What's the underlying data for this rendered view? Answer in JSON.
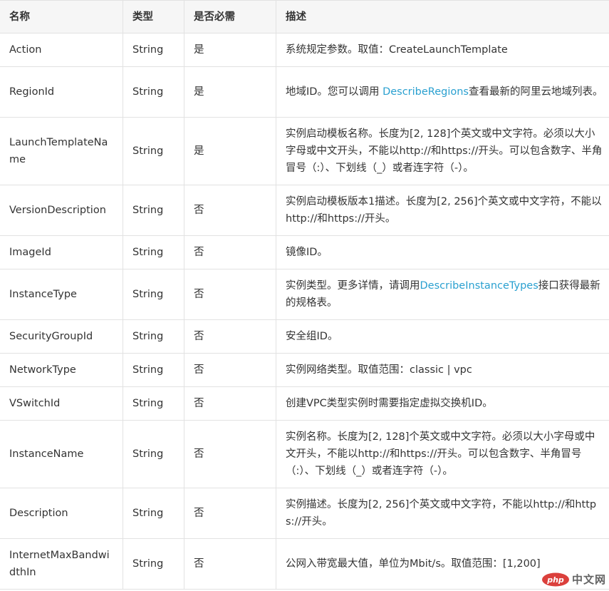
{
  "header": {
    "name": "名称",
    "type": "类型",
    "required": "是否必需",
    "description": "描述"
  },
  "rows": [
    {
      "name": "Action",
      "type": "String",
      "required": "是",
      "desc_before": "系统规定参数。取值：CreateLaunchTemplate",
      "desc_link": "",
      "desc_after": ""
    },
    {
      "name": "RegionId",
      "type": "String",
      "required": "是",
      "desc_before": "地域ID。您可以调用 ",
      "desc_link": "DescribeRegions",
      "desc_after": "查看最新的阿里云地域列表。"
    },
    {
      "name": "LaunchTemplateName",
      "type": "String",
      "required": "是",
      "desc_before": "实例启动模板名称。长度为[2, 128]个英文或中文字符。必须以大小字母或中文开头，不能以http://和https://开头。可以包含数字、半角冒号（:）、下划线（_）或者连字符（-）。",
      "desc_link": "",
      "desc_after": ""
    },
    {
      "name": "VersionDescription",
      "type": "String",
      "required": "否",
      "desc_before": "实例启动模板版本1描述。长度为[2, 256]个英文或中文字符，不能以http://和https://开头。",
      "desc_link": "",
      "desc_after": ""
    },
    {
      "name": "ImageId",
      "type": "String",
      "required": "否",
      "desc_before": "镜像ID。",
      "desc_link": "",
      "desc_after": ""
    },
    {
      "name": "InstanceType",
      "type": "String",
      "required": "否",
      "desc_before": "实例类型。更多详情，请调用",
      "desc_link": "DescribeInstanceTypes",
      "desc_after": "接口获得最新的规格表。"
    },
    {
      "name": "SecurityGroupId",
      "type": "String",
      "required": "否",
      "desc_before": "安全组ID。",
      "desc_link": "",
      "desc_after": ""
    },
    {
      "name": "NetworkType",
      "type": "String",
      "required": "否",
      "desc_before": "实例网络类型。取值范围：classic | vpc",
      "desc_link": "",
      "desc_after": ""
    },
    {
      "name": "VSwitchId",
      "type": "String",
      "required": "否",
      "desc_before": "创建VPC类型实例时需要指定虚拟交换机ID。",
      "desc_link": "",
      "desc_after": ""
    },
    {
      "name": "InstanceName",
      "type": "String",
      "required": "否",
      "desc_before": "实例名称。长度为[2, 128]个英文或中文字符。必须以大小字母或中文开头，不能以http://和https://开头。可以包含数字、半角冒号（:）、下划线（_）或者连字符（-）。",
      "desc_link": "",
      "desc_after": ""
    },
    {
      "name": "Description",
      "type": "String",
      "required": "否",
      "desc_before": "实例描述。长度为[2, 256]个英文或中文字符，不能以http://和https://开头。",
      "desc_link": "",
      "desc_after": ""
    },
    {
      "name": "InternetMaxBandwidthIn",
      "type": "String",
      "required": "否",
      "desc_before": "公网入带宽最大值，单位为Mbit/s。取值范围：[1,200]",
      "desc_link": "",
      "desc_after": ""
    }
  ],
  "watermark": {
    "logo_text": "php",
    "site_text": "中文网"
  },
  "colors": {
    "link": "#2aa0d0",
    "header_bg": "#f6f6f6",
    "border": "#e2e2e2",
    "text": "#333333"
  }
}
